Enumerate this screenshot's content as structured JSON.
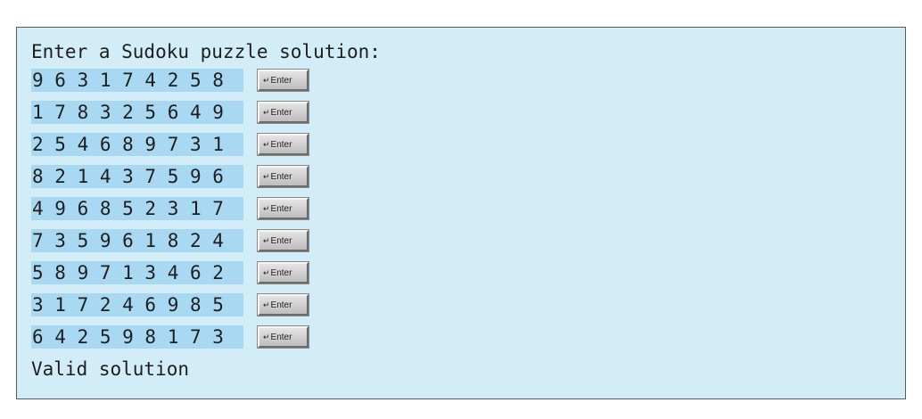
{
  "console": {
    "prompt": "Enter a Sudoku puzzle solution:",
    "rows": [
      "9 6 3 1 7 4 2 5 8",
      "1 7 8 3 2 5 6 4 9",
      "2 5 4 6 8 9 7 3 1",
      "8 2 1 4 3 7 5 9 6",
      "4 9 6 8 5 2 3 1 7",
      "7 3 5 9 6 1 8 2 4",
      "5 8 9 7 1 3 4 6 2",
      "3 1 7 2 4 6 9 8 5",
      "6 4 2 5 9 8 1 7 3"
    ],
    "enter_key": {
      "glyph": "↵",
      "label": "Enter"
    },
    "result": "Valid solution"
  },
  "colors": {
    "console_background": "#d2ecf8",
    "input_highlight": "#a9d9f2",
    "border": "#5a5a5a",
    "text": "#1e1e1e"
  }
}
